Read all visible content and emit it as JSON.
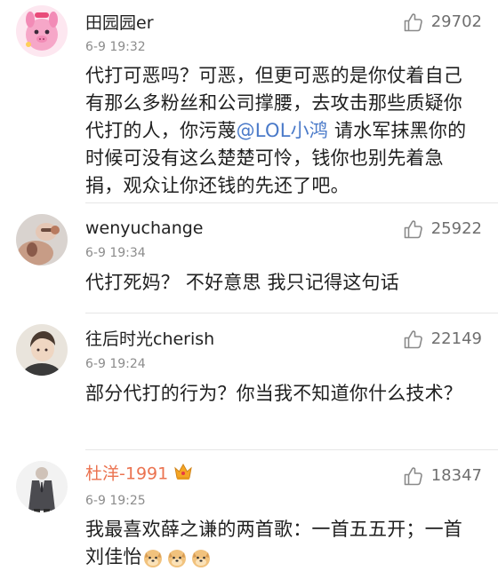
{
  "comments": [
    {
      "username": "田园园er",
      "time": "6-9 19:32",
      "likes": "29702",
      "text_before_mention": "代打可恶吗？可恶，但更可恶的是你仗着自己有那么多粉丝和公司撑腰，去攻击那些质疑你代打的人，你污蔑",
      "mention": "@LOL小鸿",
      "text_after_mention": " 请水军抹黑你的时候可没有这么楚楚可怜，钱你也别先着急捐，观众让你还钱的先还了吧。"
    },
    {
      "username": "wenyuchange",
      "time": "6-9 19:34",
      "likes": "25922",
      "text": "代打死妈？ 不好意思 我只记得这句话"
    },
    {
      "username": "往后时光cherish",
      "time": "6-9 19:24",
      "likes": "22149",
      "text": "部分代打的行为？你当我不知道你什么技术？"
    },
    {
      "username": "杜洋-1991",
      "time": "6-9 19:25",
      "likes": "18347",
      "text": "我最喜欢薛之谦的两首歌：一首五五开；一首刘佳怡",
      "badge": "crown-icon",
      "emoji": "doge-icon"
    }
  ],
  "colors": {
    "vip_name": "#eb7350",
    "mention": "#4a7ac9",
    "meta": "#8c8c8c",
    "like_count": "#6f6f6f"
  },
  "icons": {
    "like": "thumbs-up-icon"
  }
}
